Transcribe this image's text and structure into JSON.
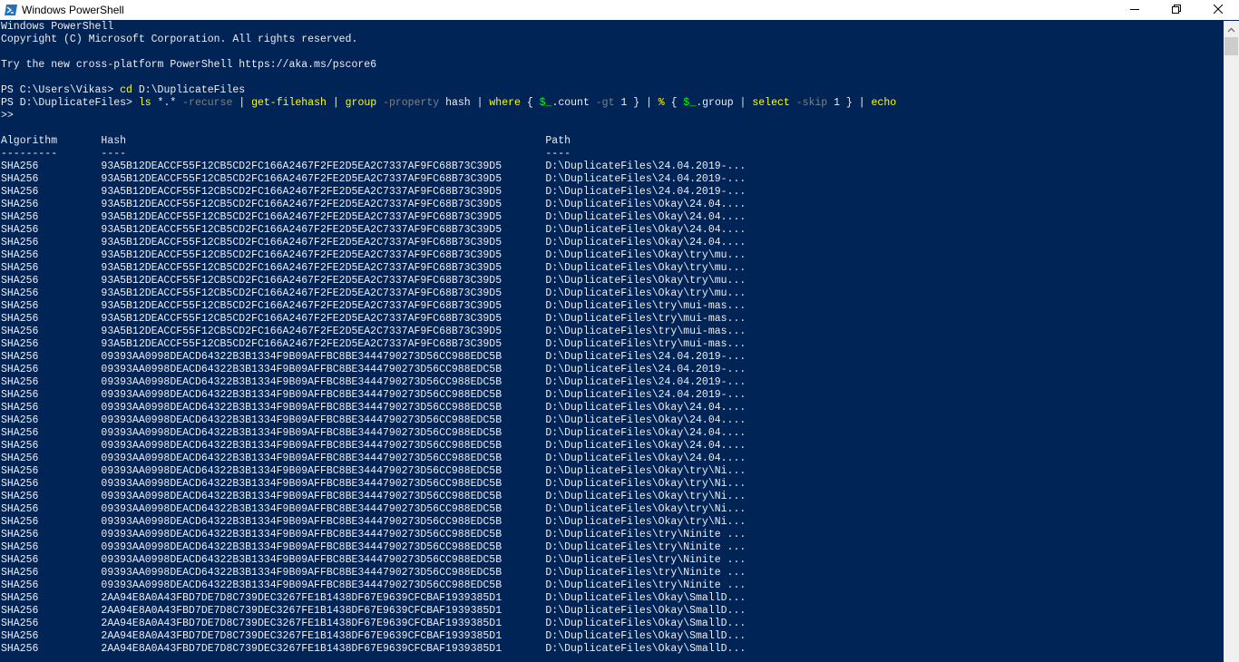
{
  "window": {
    "title": "Windows PowerShell"
  },
  "console": {
    "banner": [
      "Windows PowerShell",
      "Copyright (C) Microsoft Corporation. All rights reserved.",
      "",
      "Try the new cross-platform PowerShell https://aka.ms/pscore6",
      ""
    ],
    "prompt1": {
      "prompt": "PS C:\\Users\\Vikas> ",
      "command": "cd",
      "arg": " D:\\DuplicateFiles"
    },
    "prompt2": {
      "prompt": "PS D:\\DuplicateFiles> ",
      "parts": [
        {
          "t": "ls",
          "c": "cmd"
        },
        {
          "t": " *.* ",
          "c": ""
        },
        {
          "t": "-recurse",
          "c": "param"
        },
        {
          "t": " | ",
          "c": ""
        },
        {
          "t": "get-filehash",
          "c": "cmd"
        },
        {
          "t": " | ",
          "c": ""
        },
        {
          "t": "group",
          "c": "cmd"
        },
        {
          "t": " ",
          "c": ""
        },
        {
          "t": "-property",
          "c": "param"
        },
        {
          "t": " hash | ",
          "c": ""
        },
        {
          "t": "where",
          "c": "cmd"
        },
        {
          "t": " { ",
          "c": ""
        },
        {
          "t": "$_",
          "c": "var"
        },
        {
          "t": ".count ",
          "c": ""
        },
        {
          "t": "-gt",
          "c": "param"
        },
        {
          "t": " 1 } | ",
          "c": ""
        },
        {
          "t": "%",
          "c": "cmd"
        },
        {
          "t": " { ",
          "c": ""
        },
        {
          "t": "$_",
          "c": "var"
        },
        {
          "t": ".group | ",
          "c": ""
        },
        {
          "t": "select",
          "c": "cmd"
        },
        {
          "t": " ",
          "c": ""
        },
        {
          "t": "-skip",
          "c": "param"
        },
        {
          "t": " 1 } | ",
          "c": ""
        },
        {
          "t": "echo",
          "c": "cmd"
        }
      ]
    },
    "continuation": ">>",
    "table": {
      "headers": [
        "Algorithm",
        "Hash",
        "Path"
      ],
      "underlines": [
        "---------",
        "----",
        "----"
      ],
      "rows": [
        [
          "SHA256",
          "93A5B12DEACCF55F12CB5CD2FC166A2467F2FE2D5EA2C7337AF9FC68B73C39D5",
          "D:\\DuplicateFiles\\24.04.2019-..."
        ],
        [
          "SHA256",
          "93A5B12DEACCF55F12CB5CD2FC166A2467F2FE2D5EA2C7337AF9FC68B73C39D5",
          "D:\\DuplicateFiles\\24.04.2019-..."
        ],
        [
          "SHA256",
          "93A5B12DEACCF55F12CB5CD2FC166A2467F2FE2D5EA2C7337AF9FC68B73C39D5",
          "D:\\DuplicateFiles\\24.04.2019-..."
        ],
        [
          "SHA256",
          "93A5B12DEACCF55F12CB5CD2FC166A2467F2FE2D5EA2C7337AF9FC68B73C39D5",
          "D:\\DuplicateFiles\\Okay\\24.04...."
        ],
        [
          "SHA256",
          "93A5B12DEACCF55F12CB5CD2FC166A2467F2FE2D5EA2C7337AF9FC68B73C39D5",
          "D:\\DuplicateFiles\\Okay\\24.04...."
        ],
        [
          "SHA256",
          "93A5B12DEACCF55F12CB5CD2FC166A2467F2FE2D5EA2C7337AF9FC68B73C39D5",
          "D:\\DuplicateFiles\\Okay\\24.04...."
        ],
        [
          "SHA256",
          "93A5B12DEACCF55F12CB5CD2FC166A2467F2FE2D5EA2C7337AF9FC68B73C39D5",
          "D:\\DuplicateFiles\\Okay\\24.04...."
        ],
        [
          "SHA256",
          "93A5B12DEACCF55F12CB5CD2FC166A2467F2FE2D5EA2C7337AF9FC68B73C39D5",
          "D:\\DuplicateFiles\\Okay\\try\\mu..."
        ],
        [
          "SHA256",
          "93A5B12DEACCF55F12CB5CD2FC166A2467F2FE2D5EA2C7337AF9FC68B73C39D5",
          "D:\\DuplicateFiles\\Okay\\try\\mu..."
        ],
        [
          "SHA256",
          "93A5B12DEACCF55F12CB5CD2FC166A2467F2FE2D5EA2C7337AF9FC68B73C39D5",
          "D:\\DuplicateFiles\\Okay\\try\\mu..."
        ],
        [
          "SHA256",
          "93A5B12DEACCF55F12CB5CD2FC166A2467F2FE2D5EA2C7337AF9FC68B73C39D5",
          "D:\\DuplicateFiles\\Okay\\try\\mu..."
        ],
        [
          "SHA256",
          "93A5B12DEACCF55F12CB5CD2FC166A2467F2FE2D5EA2C7337AF9FC68B73C39D5",
          "D:\\DuplicateFiles\\try\\mui-mas..."
        ],
        [
          "SHA256",
          "93A5B12DEACCF55F12CB5CD2FC166A2467F2FE2D5EA2C7337AF9FC68B73C39D5",
          "D:\\DuplicateFiles\\try\\mui-mas..."
        ],
        [
          "SHA256",
          "93A5B12DEACCF55F12CB5CD2FC166A2467F2FE2D5EA2C7337AF9FC68B73C39D5",
          "D:\\DuplicateFiles\\try\\mui-mas..."
        ],
        [
          "SHA256",
          "93A5B12DEACCF55F12CB5CD2FC166A2467F2FE2D5EA2C7337AF9FC68B73C39D5",
          "D:\\DuplicateFiles\\try\\mui-mas..."
        ],
        [
          "SHA256",
          "09393AA0998DEACD64322B3B1334F9B09AFFBC8BE3444790273D56CC988EDC5B",
          "D:\\DuplicateFiles\\24.04.2019-..."
        ],
        [
          "SHA256",
          "09393AA0998DEACD64322B3B1334F9B09AFFBC8BE3444790273D56CC988EDC5B",
          "D:\\DuplicateFiles\\24.04.2019-..."
        ],
        [
          "SHA256",
          "09393AA0998DEACD64322B3B1334F9B09AFFBC8BE3444790273D56CC988EDC5B",
          "D:\\DuplicateFiles\\24.04.2019-..."
        ],
        [
          "SHA256",
          "09393AA0998DEACD64322B3B1334F9B09AFFBC8BE3444790273D56CC988EDC5B",
          "D:\\DuplicateFiles\\24.04.2019-..."
        ],
        [
          "SHA256",
          "09393AA0998DEACD64322B3B1334F9B09AFFBC8BE3444790273D56CC988EDC5B",
          "D:\\DuplicateFiles\\Okay\\24.04...."
        ],
        [
          "SHA256",
          "09393AA0998DEACD64322B3B1334F9B09AFFBC8BE3444790273D56CC988EDC5B",
          "D:\\DuplicateFiles\\Okay\\24.04...."
        ],
        [
          "SHA256",
          "09393AA0998DEACD64322B3B1334F9B09AFFBC8BE3444790273D56CC988EDC5B",
          "D:\\DuplicateFiles\\Okay\\24.04...."
        ],
        [
          "SHA256",
          "09393AA0998DEACD64322B3B1334F9B09AFFBC8BE3444790273D56CC988EDC5B",
          "D:\\DuplicateFiles\\Okay\\24.04...."
        ],
        [
          "SHA256",
          "09393AA0998DEACD64322B3B1334F9B09AFFBC8BE3444790273D56CC988EDC5B",
          "D:\\DuplicateFiles\\Okay\\24.04...."
        ],
        [
          "SHA256",
          "09393AA0998DEACD64322B3B1334F9B09AFFBC8BE3444790273D56CC988EDC5B",
          "D:\\DuplicateFiles\\Okay\\try\\Ni..."
        ],
        [
          "SHA256",
          "09393AA0998DEACD64322B3B1334F9B09AFFBC8BE3444790273D56CC988EDC5B",
          "D:\\DuplicateFiles\\Okay\\try\\Ni..."
        ],
        [
          "SHA256",
          "09393AA0998DEACD64322B3B1334F9B09AFFBC8BE3444790273D56CC988EDC5B",
          "D:\\DuplicateFiles\\Okay\\try\\Ni..."
        ],
        [
          "SHA256",
          "09393AA0998DEACD64322B3B1334F9B09AFFBC8BE3444790273D56CC988EDC5B",
          "D:\\DuplicateFiles\\Okay\\try\\Ni..."
        ],
        [
          "SHA256",
          "09393AA0998DEACD64322B3B1334F9B09AFFBC8BE3444790273D56CC988EDC5B",
          "D:\\DuplicateFiles\\Okay\\try\\Ni..."
        ],
        [
          "SHA256",
          "09393AA0998DEACD64322B3B1334F9B09AFFBC8BE3444790273D56CC988EDC5B",
          "D:\\DuplicateFiles\\try\\Ninite ..."
        ],
        [
          "SHA256",
          "09393AA0998DEACD64322B3B1334F9B09AFFBC8BE3444790273D56CC988EDC5B",
          "D:\\DuplicateFiles\\try\\Ninite ..."
        ],
        [
          "SHA256",
          "09393AA0998DEACD64322B3B1334F9B09AFFBC8BE3444790273D56CC988EDC5B",
          "D:\\DuplicateFiles\\try\\Ninite ..."
        ],
        [
          "SHA256",
          "09393AA0998DEACD64322B3B1334F9B09AFFBC8BE3444790273D56CC988EDC5B",
          "D:\\DuplicateFiles\\try\\Ninite ..."
        ],
        [
          "SHA256",
          "09393AA0998DEACD64322B3B1334F9B09AFFBC8BE3444790273D56CC988EDC5B",
          "D:\\DuplicateFiles\\try\\Ninite ..."
        ],
        [
          "SHA256",
          "2AA94E8A0A43FBD7DE7D8C739DEC3267FE1B1438DF67E9639CFCBAF1939385D1",
          "D:\\DuplicateFiles\\Okay\\SmallD..."
        ],
        [
          "SHA256",
          "2AA94E8A0A43FBD7DE7D8C739DEC3267FE1B1438DF67E9639CFCBAF1939385D1",
          "D:\\DuplicateFiles\\Okay\\SmallD..."
        ],
        [
          "SHA256",
          "2AA94E8A0A43FBD7DE7D8C739DEC3267FE1B1438DF67E9639CFCBAF1939385D1",
          "D:\\DuplicateFiles\\Okay\\SmallD..."
        ],
        [
          "SHA256",
          "2AA94E8A0A43FBD7DE7D8C739DEC3267FE1B1438DF67E9639CFCBAF1939385D1",
          "D:\\DuplicateFiles\\Okay\\SmallD..."
        ],
        [
          "SHA256",
          "2AA94E8A0A43FBD7DE7D8C739DEC3267FE1B1438DF67E9639CFCBAF1939385D1",
          "D:\\DuplicateFiles\\Okay\\SmallD..."
        ]
      ]
    }
  },
  "colors": {
    "background": "#012456",
    "foreground": "#eeedf0",
    "command": "#ffff00",
    "parameter": "#808080",
    "variable": "#00ff00"
  },
  "icons": {
    "app": "powershell-icon",
    "minimize": "minimize-icon",
    "maximize": "restore-icon",
    "close": "close-icon"
  }
}
